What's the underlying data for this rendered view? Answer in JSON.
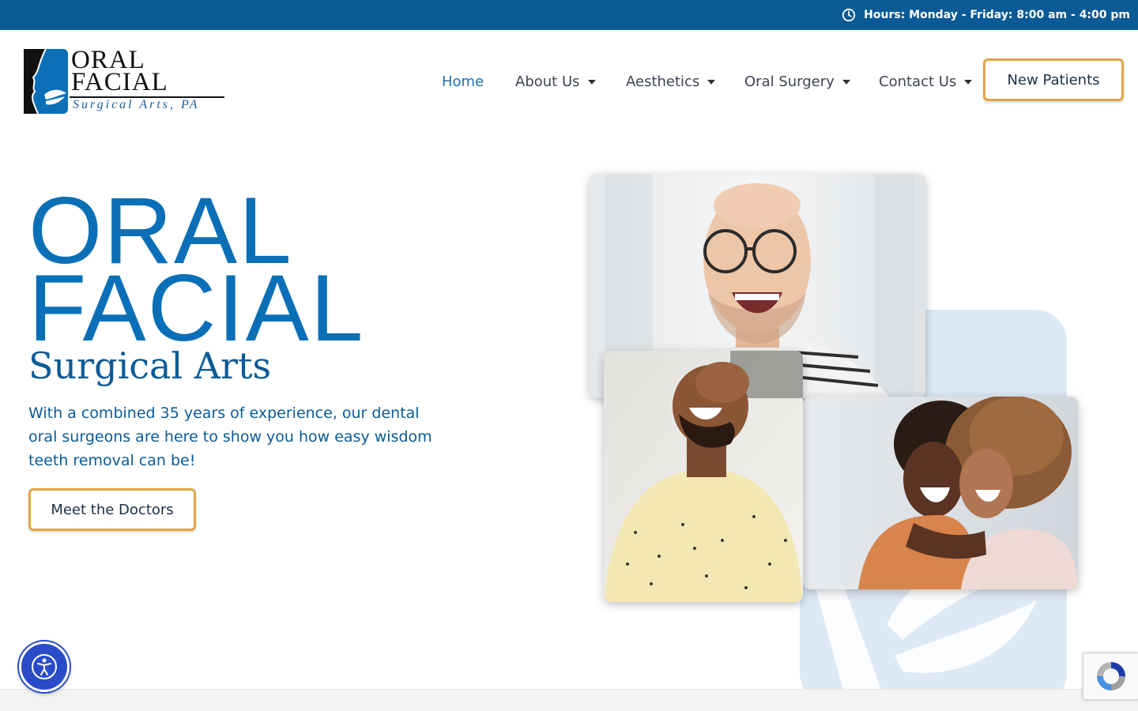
{
  "topbar": {
    "hours_text": "Hours: Monday - Friday: 8:00 am - 4:00 pm",
    "icon": "clock-icon",
    "background_color": "#0b5a96"
  },
  "logo": {
    "line1": "ORAL",
    "line2": "FACIAL",
    "line3": "Surgical Arts, PA",
    "icon": "face-profile-logo-icon"
  },
  "nav": {
    "items": [
      {
        "label": "Home",
        "active": true,
        "has_dropdown": false
      },
      {
        "label": "About Us",
        "active": false,
        "has_dropdown": true
      },
      {
        "label": "Aesthetics",
        "active": false,
        "has_dropdown": true
      },
      {
        "label": "Oral Surgery",
        "active": false,
        "has_dropdown": true
      },
      {
        "label": "Contact Us",
        "active": false,
        "has_dropdown": true
      }
    ],
    "cta_label": "New Patients",
    "active_color": "#1e6fae"
  },
  "hero": {
    "title_line1": "ORAL",
    "title_line2": "FACIAL",
    "subtitle": "Surgical Arts",
    "description": "With a combined 35 years of experience, our dental oral surgeons are here to show you how easy wisdom teeth removal can be!",
    "cta_label": "Meet the Doctors",
    "title_color": "#0a6fb7",
    "button_border_color": "#e0a447"
  },
  "photos": [
    {
      "name": "smiling-man-glasses-photo"
    },
    {
      "name": "laughing-man-photo"
    },
    {
      "name": "two-women-laughing-photo"
    }
  ],
  "widgets": {
    "accessibility_icon": "accessibility-icon",
    "recaptcha_icon": "recaptcha-icon"
  }
}
